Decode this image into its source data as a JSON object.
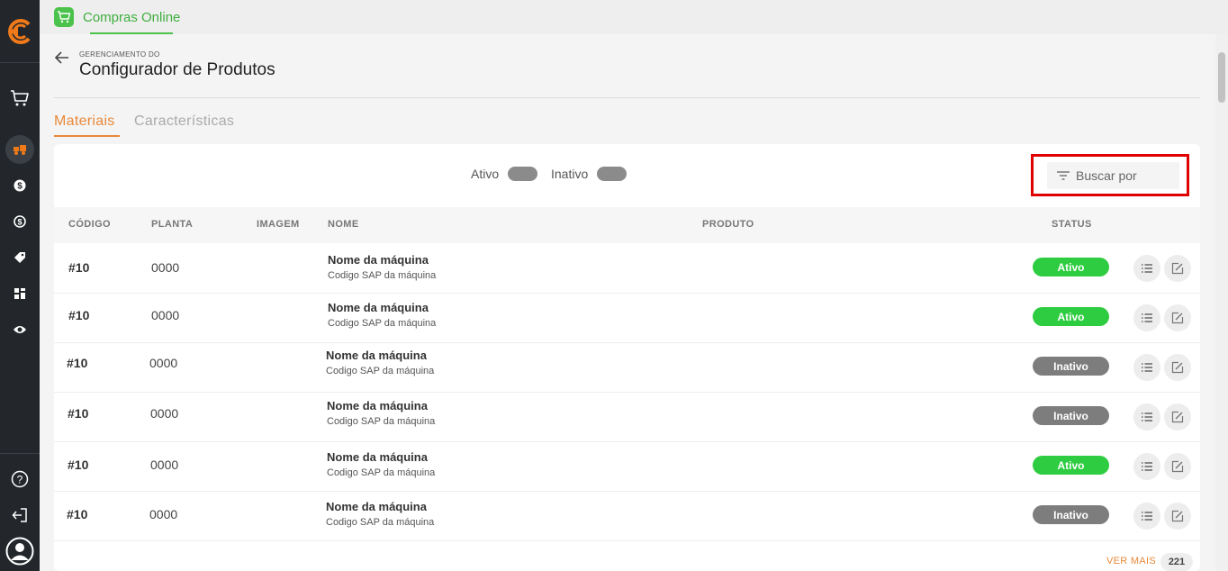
{
  "app": {
    "tab_label": "Compras Online"
  },
  "header": {
    "kicker": "GERENCIAMENTO DO",
    "title": "Configurador de Produtos"
  },
  "tabs": [
    {
      "label": "Materiais",
      "active": true
    },
    {
      "label": "Características",
      "active": false
    }
  ],
  "filters": {
    "active_label": "Ativo",
    "inactive_label": "Inativo"
  },
  "search": {
    "placeholder": "Buscar por"
  },
  "table": {
    "headers": [
      "CÓDIGO",
      "PLANTA",
      "IMAGEM",
      "NOME",
      "PRODUTO",
      "STATUS"
    ],
    "rows": [
      {
        "code": "#10",
        "plant": "0000",
        "name": "Nome da máquina",
        "sap": "Codigo SAP da máquina",
        "status": "Ativo"
      },
      {
        "code": "#10",
        "plant": "0000",
        "name": "Nome da máquina",
        "sap": "Codigo SAP da máquina",
        "status": "Ativo"
      },
      {
        "code": "#10",
        "plant": "0000",
        "name": "Nome da máquina",
        "sap": "Codigo SAP da máquina",
        "status": "Inativo"
      },
      {
        "code": "#10",
        "plant": "0000",
        "name": "Nome da máquina",
        "sap": "Codigo SAP da máquina",
        "status": "Inativo"
      },
      {
        "code": "#10",
        "plant": "0000",
        "name": "Nome da máquina",
        "sap": "Codigo SAP da máquina",
        "status": "Ativo"
      },
      {
        "code": "#10",
        "plant": "0000",
        "name": "Nome da máquina",
        "sap": "Codigo SAP da máquina",
        "status": "Inativo"
      }
    ]
  },
  "footer": {
    "see_more": "VER MAIS",
    "count": "221"
  },
  "colors": {
    "accent": "#e8893a",
    "active": "#2ecc40",
    "inactive": "#7d7d7d",
    "sidebar": "#23272c",
    "app_green": "#4bc24b",
    "highlight": "#e00000"
  },
  "icons": {
    "sidebar": [
      "logo-icon",
      "cart-icon",
      "machine-icon",
      "dollar-icon",
      "exchange-icon",
      "tag-icon",
      "dashboard-icon",
      "eye-icon",
      "help-icon",
      "logout-icon",
      "user-icon"
    ],
    "row_actions": [
      "list-icon",
      "edit-icon"
    ],
    "search": "filter-icon"
  }
}
